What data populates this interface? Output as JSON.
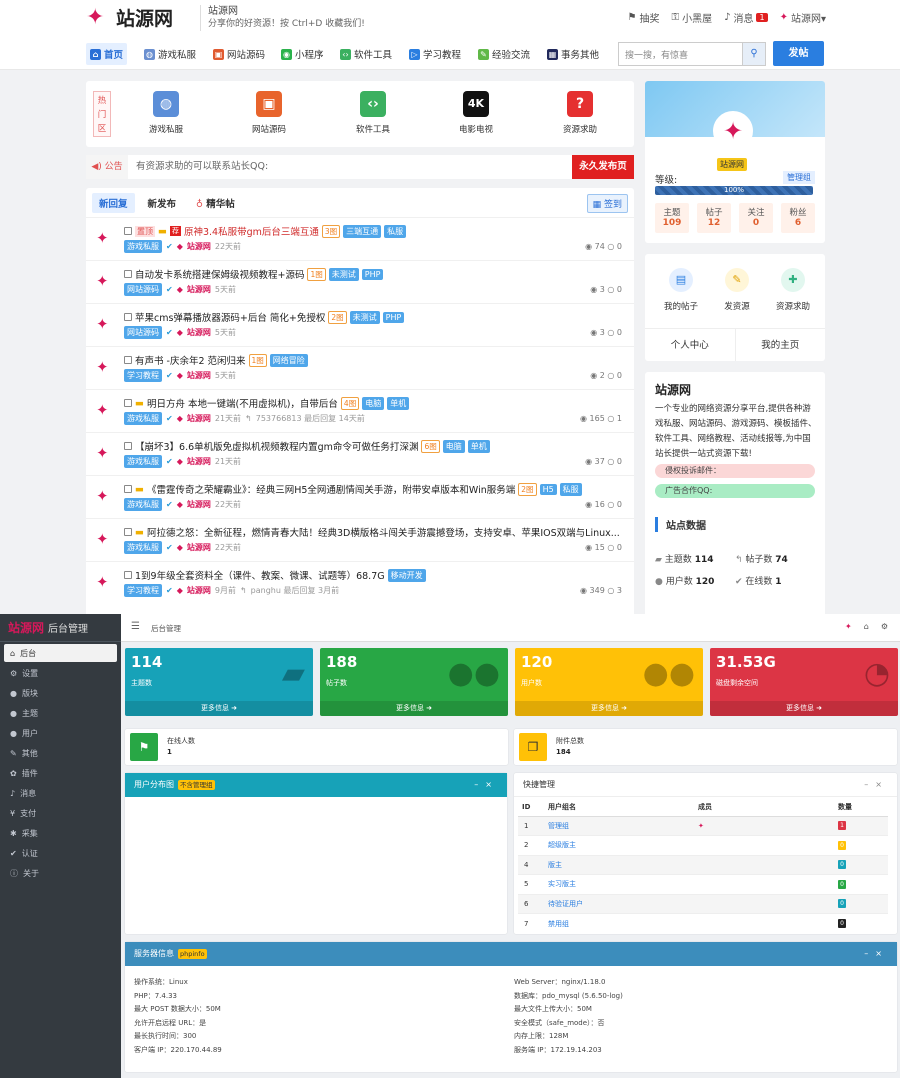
{
  "site": {
    "logo": "站源网",
    "slogan_title": "站源网",
    "slogan_sub": "分享你的好资源！按 Ctrl+D 收藏我们!"
  },
  "toplinks": [
    {
      "label": "抽奖",
      "icon": "gift-icon"
    },
    {
      "label": "小黑屋",
      "icon": "key-icon"
    },
    {
      "label": "消息",
      "icon": "bell-icon",
      "badge": "1"
    },
    {
      "label": "站源网▾",
      "icon": "avatar-icon"
    }
  ],
  "nav": [
    {
      "label": "首页",
      "color": "#2a6fd6",
      "glyph": "⌂"
    },
    {
      "label": "游戏私服",
      "color": "#6a8fd0",
      "glyph": "◍"
    },
    {
      "label": "网站源码",
      "color": "#e05a30",
      "glyph": "▣"
    },
    {
      "label": "小程序",
      "color": "#2bb24c",
      "glyph": "◉"
    },
    {
      "label": "软件工具",
      "color": "#3bb060",
      "glyph": "‹›"
    },
    {
      "label": "学习教程",
      "color": "#2a7ee0",
      "glyph": "▷"
    },
    {
      "label": "经验交流",
      "color": "#60b848",
      "glyph": "✎"
    },
    {
      "label": "事务其他",
      "color": "#222a5c",
      "glyph": "▦"
    }
  ],
  "search": {
    "placeholder": "搜一搜，有惊喜",
    "post_label": "发帖"
  },
  "hot": {
    "label": "热门区",
    "items": [
      {
        "label": "游戏私服",
        "color": "#5b8ed8",
        "glyph": "◍"
      },
      {
        "label": "网站源码",
        "color": "#e8642c",
        "glyph": "▣"
      },
      {
        "label": "软件工具",
        "color": "#3bb060",
        "glyph": "‹›"
      },
      {
        "label": "电影电视",
        "color": "#111111",
        "glyph": "4K"
      },
      {
        "label": "资源求助",
        "color": "#e53030",
        "glyph": "?"
      }
    ]
  },
  "notice": {
    "tag": "◀) 公告",
    "text": "有资源求助的可以联系站长QQ:",
    "button": "永久发布页"
  },
  "tabs": [
    "新回复",
    "新发布",
    "精华帖"
  ],
  "sign_label": "签到",
  "threads": [
    {
      "prefix": "置顶",
      "title": "原神3.4私服带gm后台三端互通",
      "imgs": "3图",
      "tags": [
        "三端互通",
        "私服"
      ],
      "category": "游戏私服",
      "author": "站源网",
      "time": "22天前",
      "views": "74",
      "replies": "0",
      "hot": true
    },
    {
      "title": "自动发卡系统搭建保姆级视频教程+源码",
      "imgs": "1图",
      "tags": [
        "未测试",
        "PHP"
      ],
      "category": "网站源码",
      "author": "站源网",
      "time": "5天前",
      "views": "3",
      "replies": "0"
    },
    {
      "title": "苹果cms弹幕播放器源码+后台 简化+免授权",
      "imgs": "2图",
      "tags": [
        "未测试",
        "PHP"
      ],
      "category": "网站源码",
      "author": "站源网",
      "time": "5天前",
      "views": "3",
      "replies": "0"
    },
    {
      "title": "有声书 -庆余年2 范闲归来",
      "imgs": "1图",
      "tags": [
        "网络冒险"
      ],
      "category": "学习教程",
      "author": "站源网",
      "time": "5天前",
      "views": "2",
      "replies": "0"
    },
    {
      "title": "明日方舟 本地一键端(不用虚拟机)，自带后台",
      "imgs": "4图",
      "tags": [
        "电脑",
        "单机"
      ],
      "category": "游戏私服",
      "author": "站源网",
      "time": "21天前",
      "extra": "753766813  最后回复 14天前",
      "views": "165",
      "replies": "1"
    },
    {
      "title": "【崩坏3】6.6单机版免虚拟机视频教程内置gm命令可做任务打深渊",
      "imgs": "6图",
      "tags": [
        "电脑",
        "单机"
      ],
      "category": "游戏私服",
      "author": "站源网",
      "time": "21天前",
      "views": "37",
      "replies": "0"
    },
    {
      "title": "《雷霆传奇之荣耀霸业》：经典三网H5全网通剧情闯关手游，附带安卓版本和Win服务端",
      "imgs": "2图",
      "tags": [
        "H5",
        "私服"
      ],
      "category": "游戏私服",
      "author": "站源网",
      "time": "22天前",
      "views": "16",
      "replies": "0"
    },
    {
      "title": "阿拉德之怒：全新征程，燃情青春大陆！经典3D横版格斗闯关手游震撼登场，支持安卓、苹果IOS双端与Linux...",
      "category": "游戏私服",
      "author": "站源网",
      "time": "22天前",
      "views": "15",
      "replies": "0"
    },
    {
      "title": "1到9年级全套资料全（课件、教案、微课、试题等）68.7G",
      "tags": [
        "移动开发"
      ],
      "category": "学习教程",
      "author": "站源网",
      "time": "9月前",
      "extra": "panghu  最后回复 3月前",
      "views": "349",
      "replies": "3"
    }
  ],
  "profile": {
    "name": "站源网",
    "level_label": "等级:",
    "group": "管理组",
    "progress": "100%",
    "stats": [
      {
        "label": "主题",
        "value": "109"
      },
      {
        "label": "帖子",
        "value": "12"
      },
      {
        "label": "关注",
        "value": "0"
      },
      {
        "label": "粉丝",
        "value": "6"
      }
    ]
  },
  "quick": {
    "items": [
      {
        "label": "我的帖子",
        "glyph": "▤",
        "bg": "#e4efff",
        "fg": "#2a7ee0"
      },
      {
        "label": "发资源",
        "glyph": "✎",
        "bg": "#fff6d8",
        "fg": "#e0a000"
      },
      {
        "label": "资源求助",
        "glyph": "✚",
        "bg": "#e2f7ef",
        "fg": "#30b080"
      }
    ],
    "links": [
      "个人中心",
      "我的主页"
    ]
  },
  "about": {
    "title": "站源网",
    "desc": "一个专业的网络资源分享平台,提供各种游戏私服、网站源码、游戏源码、模板插件、软件工具、网络教程、活动线报等,为中国站长提供一站式资源下载!",
    "pill1": "侵权投诉邮件：",
    "pill2": "广告合作QQ:",
    "stats_title": "站点数据",
    "stats": [
      {
        "label": "主题数",
        "value": "114"
      },
      {
        "label": "帖子数",
        "value": "74"
      },
      {
        "label": "用户数",
        "value": "120"
      },
      {
        "label": "在线数",
        "value": "1"
      }
    ]
  },
  "admin": {
    "logo": "站源网",
    "logo_sub": "后台管理",
    "title": "后台管理",
    "sidebar": [
      {
        "label": "后台",
        "glyph": "⌂"
      },
      {
        "label": "设置",
        "glyph": "⚙"
      },
      {
        "label": "版块",
        "glyph": "●"
      },
      {
        "label": "主题",
        "glyph": "●"
      },
      {
        "label": "用户",
        "glyph": "●"
      },
      {
        "label": "其他",
        "glyph": "✎"
      },
      {
        "label": "插件",
        "glyph": "✿"
      },
      {
        "label": "消息",
        "glyph": "♪"
      },
      {
        "label": "支付",
        "glyph": "¥"
      },
      {
        "label": "采集",
        "glyph": "✱"
      },
      {
        "label": "认证",
        "glyph": "✔"
      },
      {
        "label": "关于",
        "glyph": "ⓘ"
      }
    ],
    "stats": [
      {
        "value": "114",
        "label": "主题数",
        "color": "#17a2b8",
        "glyph": "▰"
      },
      {
        "value": "188",
        "label": "帖子数",
        "color": "#28a745",
        "glyph": "●●"
      },
      {
        "value": "120",
        "label": "用户数",
        "color": "#ffc107",
        "glyph": "●●"
      },
      {
        "value": "31.53G",
        "label": "磁盘剩余空间",
        "color": "#dc3545",
        "glyph": "◔"
      }
    ],
    "more": "更多信息 ➜",
    "online": {
      "label": "在线人数",
      "value": "1"
    },
    "attach": {
      "label": "附件总数",
      "value": "184"
    },
    "userdist": {
      "title": "用户分布图",
      "tag": "不含管理组"
    },
    "quickmgmt": {
      "title": "快捷管理",
      "headers": [
        "ID",
        "用户组名",
        "成员",
        "数量"
      ],
      "rows": [
        {
          "id": "1",
          "name": "管理组",
          "member": "✦",
          "count": "1",
          "color": "#dc3545"
        },
        {
          "id": "2",
          "name": "超级版主",
          "member": "",
          "count": "0",
          "color": "#ffc107"
        },
        {
          "id": "4",
          "name": "版主",
          "member": "",
          "count": "0",
          "color": "#17a2b8"
        },
        {
          "id": "5",
          "name": "实习版主",
          "member": "",
          "count": "0",
          "color": "#28a745"
        },
        {
          "id": "6",
          "name": "待验证用户",
          "member": "",
          "count": "0",
          "color": "#17a2b8"
        },
        {
          "id": "7",
          "name": "禁用组",
          "member": "",
          "count": "0",
          "color": "#222222"
        }
      ]
    },
    "server": {
      "title": "服务器信息",
      "tag": "phpinfo",
      "left": [
        "操作系统：Linux",
        "PHP：7.4.33",
        "最大 POST 数据大小：50M",
        "允许开启远程 URL：是",
        "最长执行时间：300",
        "客户端 IP：220.170.44.89"
      ],
      "right": [
        "Web Server：nginx/1.18.0",
        "数据库：pdo_mysql (5.6.50-log)",
        "最大文件上传大小：50M",
        "安全模式（safe_mode）：否",
        "内存上限：128M",
        "服务端 IP：172.19.14.203"
      ]
    }
  }
}
